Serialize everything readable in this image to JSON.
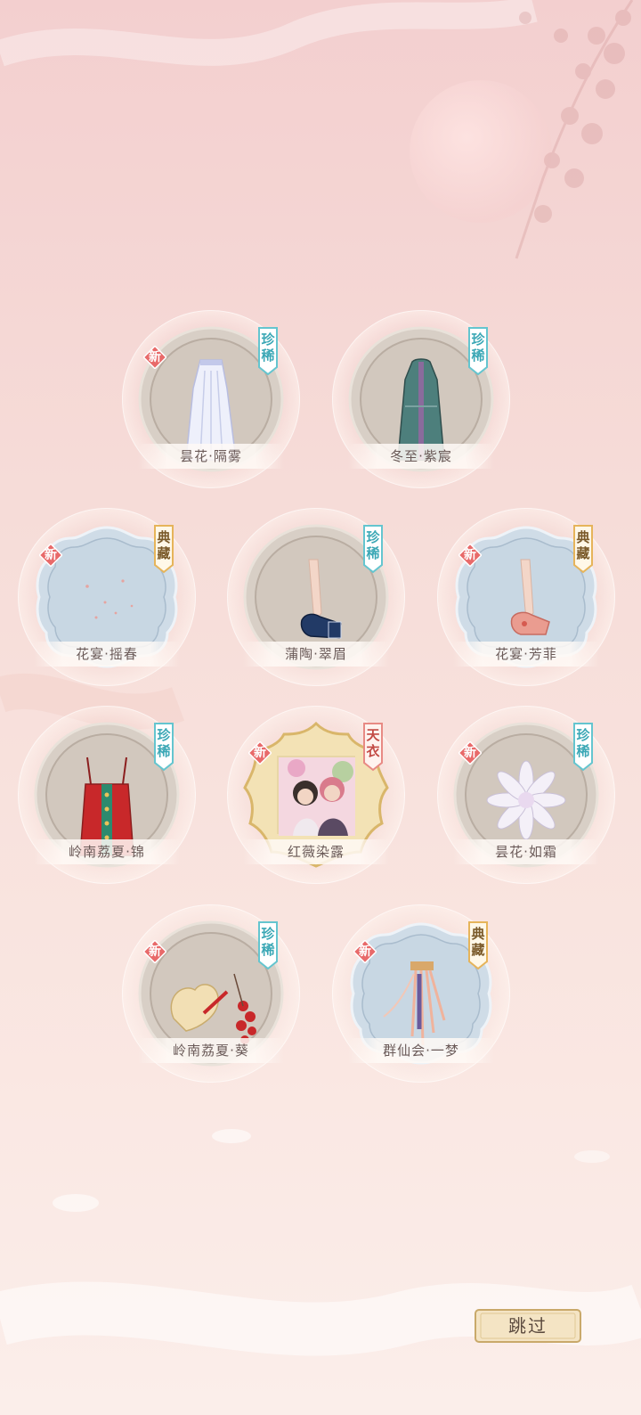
{
  "colors": {
    "new_badge": "#e86a6a",
    "rare_badge": "#64c5cf",
    "collect_badge": "#e6b45a",
    "celestial_badge": "#e88a84",
    "circle_frame": "#cfc6bd",
    "cloud_frame": "#c9d7e2",
    "gold_frame": "#e8cf8e"
  },
  "items": [
    {
      "name": "昙花·隔雾",
      "rank": "珍稀",
      "new_label": "新",
      "frame": "circle",
      "icon": "skirt-icon"
    },
    {
      "name": "冬至·紫宸",
      "rank": "珍稀",
      "new_label": "",
      "frame": "circle",
      "icon": "robe-icon"
    },
    {
      "name": "花宴·摇春",
      "rank": "典藏",
      "new_label": "新",
      "frame": "cloud",
      "icon": "petals-icon"
    },
    {
      "name": "蒲陶·翠眉",
      "rank": "珍稀",
      "new_label": "",
      "frame": "circle",
      "icon": "shoe-icon"
    },
    {
      "name": "花宴·芳菲",
      "rank": "典藏",
      "new_label": "新",
      "frame": "cloud",
      "icon": "shoe-icon"
    },
    {
      "name": "岭南荔夏·锦",
      "rank": "珍稀",
      "new_label": "",
      "frame": "circle",
      "icon": "dress-icon"
    },
    {
      "name": "红薇染露",
      "rank": "天衣",
      "new_label": "新",
      "frame": "gold",
      "icon": "portrait-icon"
    },
    {
      "name": "昙花·如霜",
      "rank": "珍稀",
      "new_label": "新",
      "frame": "circle",
      "icon": "flower-icon"
    },
    {
      "name": "岭南荔夏·葵",
      "rank": "珍稀",
      "new_label": "新",
      "frame": "circle",
      "icon": "fan-icon"
    },
    {
      "name": "群仙会·一梦",
      "rank": "典藏",
      "new_label": "新",
      "frame": "cloud",
      "icon": "ribbon-icon"
    }
  ],
  "skip_label": "跳过"
}
